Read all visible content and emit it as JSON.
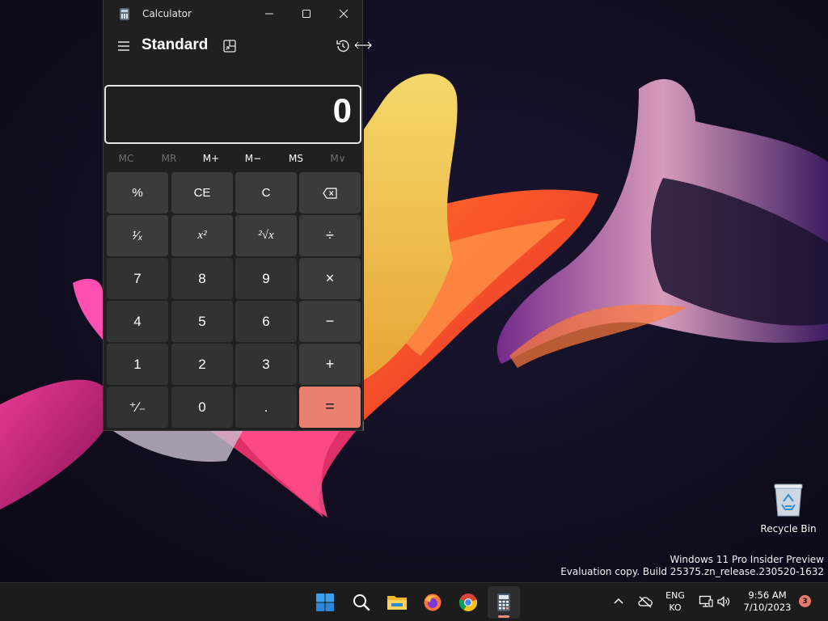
{
  "window": {
    "title": "Calculator",
    "mode": "Standard",
    "display_value": "0"
  },
  "memory": [
    {
      "label": "MC",
      "enabled": false
    },
    {
      "label": "MR",
      "enabled": false
    },
    {
      "label": "M+",
      "enabled": true
    },
    {
      "label": "M−",
      "enabled": true
    },
    {
      "label": "MS",
      "enabled": true
    },
    {
      "label": "M∨",
      "enabled": false
    }
  ],
  "keys": [
    [
      "%",
      "CE",
      "C",
      "⌫"
    ],
    [
      "¹⁄ₓ",
      "x²",
      "²√x",
      "÷"
    ],
    [
      "7",
      "8",
      "9",
      "×"
    ],
    [
      "4",
      "5",
      "6",
      "−"
    ],
    [
      "1",
      "2",
      "3",
      "+"
    ],
    [
      "⁺⁄₋",
      "0",
      ".",
      "="
    ]
  ],
  "desktop": {
    "recycle_bin_label": "Recycle Bin",
    "watermark_line1": "Windows 11 Pro Insider Preview",
    "watermark_line2": "Evaluation copy. Build 25375.zn_release.230520-1632"
  },
  "taskbar": {
    "apps": [
      "start-icon",
      "search-icon",
      "file-explorer-icon",
      "firefox-icon",
      "chrome-icon",
      "calculator-icon"
    ],
    "lang_line1": "ENG",
    "lang_line2": "KO",
    "time": "9:56 AM",
    "date": "7/10/2023",
    "notification_count": "3"
  },
  "colors": {
    "accent": "#ea8070",
    "window_bg": "#202020",
    "key_bg": "#3b3b3b",
    "num_key_bg": "#323232",
    "taskbar_bg": "#1c1c1c"
  }
}
